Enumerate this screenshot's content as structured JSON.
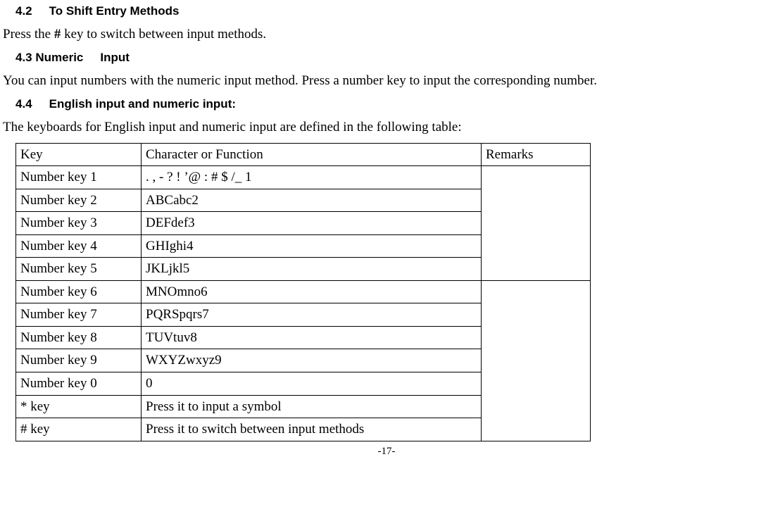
{
  "sections": {
    "s42": {
      "heading_num": "4.2",
      "heading_text": "To Shift Entry Methods",
      "body": "Press the # key to switch between input methods."
    },
    "s43": {
      "heading_num": "4.3 Numeric",
      "heading_text": "Input",
      "body": "You can input numbers with the numeric input method. Press a number key to input the corresponding number."
    },
    "s44": {
      "heading_num": "4.4",
      "heading_text": "English input and numeric input:",
      "body": "The keyboards for English input and numeric input are defined in the following table:"
    }
  },
  "table": {
    "header": {
      "c1": "Key",
      "c2": "Character or Function",
      "c3": "Remarks"
    },
    "rows": [
      {
        "key": "Number key 1",
        "char": ". , - ? ! ’@ : # $ /_ 1"
      },
      {
        "key": "Number key 2",
        "char": "ABCabc2"
      },
      {
        "key": "Number key 3",
        "char": "DEFdef3"
      },
      {
        "key": "Number key 4",
        "char": "GHIghi4"
      },
      {
        "key": "Number key 5",
        "char": "JKLjkl5"
      },
      {
        "key": "Number key 6",
        "char": "MNOmno6"
      },
      {
        "key": "Number key 7",
        "char": "PQRSpqrs7"
      },
      {
        "key": "Number key 8",
        "char": "TUVtuv8"
      },
      {
        "key": "Number key 9",
        "char": "WXYZwxyz9"
      },
      {
        "key": "Number key 0",
        "char": "0"
      },
      {
        "key": "* key",
        "char": "Press it to input a symbol"
      },
      {
        "key": "# key",
        "char": "Press it to switch between input methods"
      }
    ]
  },
  "footer": "-17-"
}
